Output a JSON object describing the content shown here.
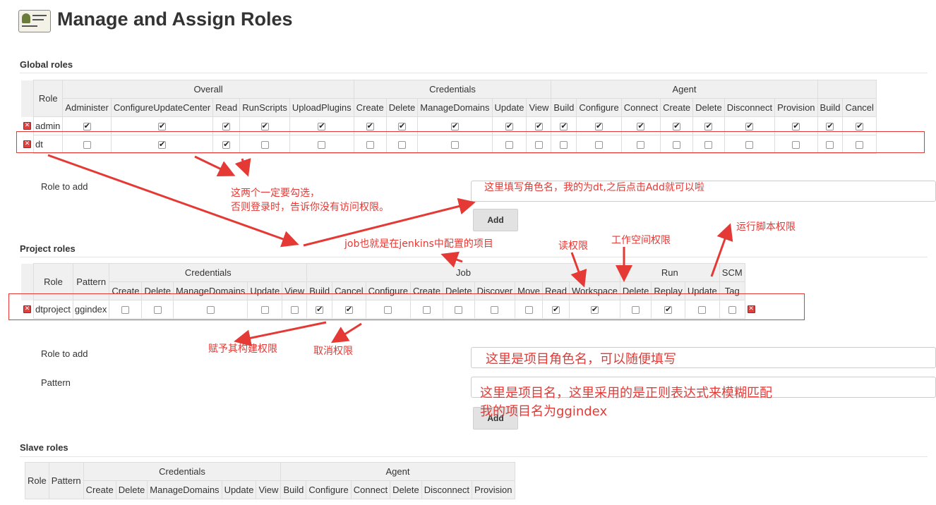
{
  "page": {
    "title": "Manage and Assign Roles"
  },
  "global": {
    "section_title": "Global roles",
    "role_header": "Role",
    "groups": [
      "Overall",
      "Credentials",
      "Agent",
      ""
    ],
    "columns": [
      "Administer",
      "ConfigureUpdateCenter",
      "Read",
      "RunScripts",
      "UploadPlugins",
      "Create",
      "Delete",
      "ManageDomains",
      "Update",
      "View",
      "Build",
      "Configure",
      "Connect",
      "Create",
      "Delete",
      "Disconnect",
      "Provision",
      "Build",
      "Cancel"
    ],
    "rows": [
      {
        "name": "admin",
        "checks": [
          true,
          true,
          true,
          true,
          true,
          true,
          true,
          true,
          true,
          true,
          true,
          true,
          true,
          true,
          true,
          true,
          true,
          true,
          true
        ]
      },
      {
        "name": "dt",
        "checks": [
          false,
          true,
          true,
          false,
          false,
          false,
          false,
          false,
          false,
          false,
          false,
          false,
          false,
          false,
          false,
          false,
          false,
          false,
          false
        ]
      }
    ],
    "role_to_add_label": "Role to add",
    "add_button": "Add"
  },
  "project": {
    "section_title": "Project roles",
    "role_header": "Role",
    "pattern_header": "Pattern",
    "groups": [
      "Credentials",
      "Job",
      "Run",
      "SCM"
    ],
    "columns": [
      "Create",
      "Delete",
      "ManageDomains",
      "Update",
      "View",
      "Build",
      "Cancel",
      "Configure",
      "Create",
      "Delete",
      "Discover",
      "Move",
      "Read",
      "Workspace",
      "Delete",
      "Replay",
      "Update",
      "Tag"
    ],
    "rows": [
      {
        "name": "dtproject",
        "pattern": "ggindex",
        "checks": [
          false,
          false,
          false,
          false,
          false,
          true,
          true,
          false,
          false,
          false,
          false,
          false,
          true,
          true,
          false,
          true,
          false,
          false
        ]
      }
    ],
    "role_to_add_label": "Role to add",
    "pattern_label": "Pattern",
    "add_button": "Add"
  },
  "slave": {
    "section_title": "Slave roles",
    "role_header": "Role",
    "pattern_header": "Pattern",
    "groups": [
      "Credentials",
      "Agent"
    ],
    "columns": [
      "Create",
      "Delete",
      "ManageDomains",
      "Update",
      "View",
      "Build",
      "Configure",
      "Connect",
      "Delete",
      "Disconnect",
      "Provision"
    ]
  },
  "annotations": {
    "must_check": "这两个一定要勾选，",
    "must_check_2": "否则登录时，告诉你没有访问权限。",
    "fill_role_name": "这里填写角色名，我的为dt,之后点击Add就可以啦",
    "run_script": "运行脚本权限",
    "workspace": "工作空间权限",
    "read": "读权限",
    "job_meaning": "job也就是在jenkins中配置的项目",
    "build_perm": "赋予其构建权限",
    "cancel_perm": "取消权限",
    "project_role_name": "这里是项目角色名，可以随便填写",
    "project_name_1": "这里是项目名，这里采用的是正则表达式来模糊匹配",
    "project_name_2": "我的项目名为ggindex"
  },
  "colors": {
    "annotation": "#e53935",
    "header_bg": "#f0f0f0",
    "grid_border": "#dddddd"
  }
}
